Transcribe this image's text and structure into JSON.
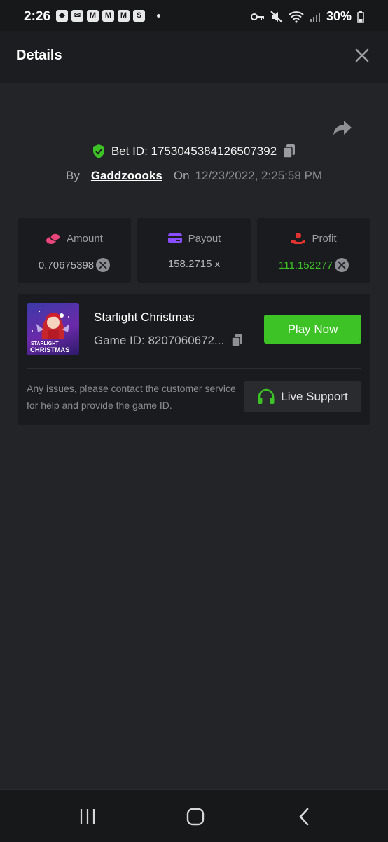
{
  "status": {
    "time": "2:26",
    "battery": "30%",
    "colors": {
      "bar": "#17181a"
    }
  },
  "header": {
    "title": "Details",
    "close_icon": "close-icon"
  },
  "bet": {
    "label": "Bet ID: 1753045384126507392",
    "by_label": "By",
    "user": "Gaddzoooks",
    "on_label": "On",
    "datetime": "12/23/2022, 2:25:58 PM"
  },
  "stats": [
    {
      "label": "Amount",
      "value": "0.70675398",
      "icon": "coins-icon",
      "icon_color": "#e8457a",
      "value_color": "#b5b6bb"
    },
    {
      "label": "Payout",
      "value": "158.2715 x",
      "icon": "wallet-icon",
      "icon_color": "#8a4dff",
      "value_color": "#b5b6bb"
    },
    {
      "label": "Profit",
      "value": "111.152277",
      "icon": "hand-coin-icon",
      "icon_color": "#e2332f",
      "value_color": "#3dc326"
    }
  ],
  "game": {
    "name": "Starlight Christmas",
    "id": "Game ID: 8207060672...",
    "thumb_line1": "STARLIGHT",
    "thumb_line2": "CHRISTMAS",
    "play_label": "Play Now"
  },
  "support": {
    "notice": "Any issues, please contact the customer service for help and provide the game ID.",
    "button_label": "Live Support"
  },
  "colors": {
    "accent": "#3dc326",
    "background": "#232427",
    "card": "#1a1b1e"
  }
}
